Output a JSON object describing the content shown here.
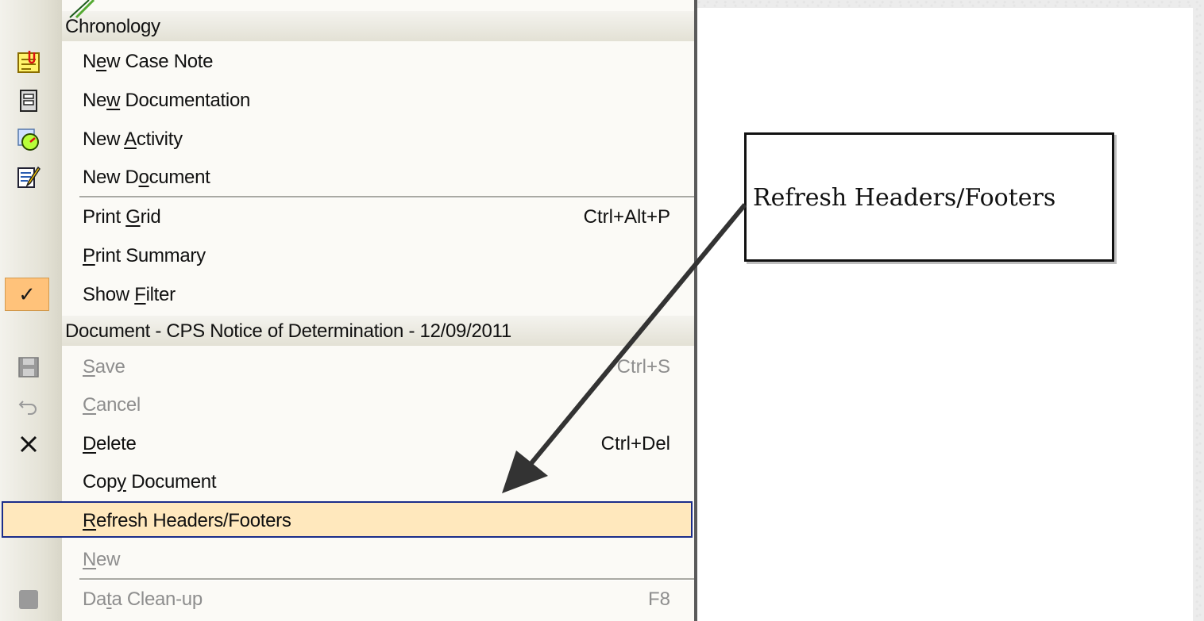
{
  "sections": {
    "chronology": "Chronology",
    "document": "Document - CPS Notice of Determination - 12/09/2011"
  },
  "chronology_items": [
    {
      "label": "New Case Note",
      "icon": "case-note-icon"
    },
    {
      "label": "New Documentation",
      "icon": "documentation-icon"
    },
    {
      "label": "New Activity",
      "icon": "activity-icon"
    },
    {
      "label": "New Document",
      "icon": "document-edit-icon"
    },
    {
      "label": "Print Grid",
      "shortcut": "Ctrl+Alt+P"
    },
    {
      "label": "Print Summary"
    },
    {
      "label": "Show Filter",
      "checked": true
    }
  ],
  "document_items": [
    {
      "label": "Save",
      "shortcut": "Ctrl+S",
      "disabled": true,
      "icon": "save-icon"
    },
    {
      "label": "Cancel",
      "disabled": true,
      "icon": "undo-icon"
    },
    {
      "label": "Delete",
      "shortcut": "Ctrl+Del",
      "icon": "delete-icon"
    },
    {
      "label": "Copy Document"
    },
    {
      "label": "Refresh Headers/Footers",
      "highlighted": true
    },
    {
      "label": "New",
      "disabled": true
    },
    {
      "label": "Data Clean-up",
      "shortcut": "F8",
      "disabled": true,
      "icon": "data-cleanup-icon"
    }
  ],
  "callout": {
    "text": "Refresh Headers/Footers"
  },
  "colors": {
    "highlight_fill": "#ffe8bd",
    "highlight_border": "#1b2d8a",
    "check_fill": "#ffc27a",
    "disabled_text": "#8e8e8e"
  }
}
